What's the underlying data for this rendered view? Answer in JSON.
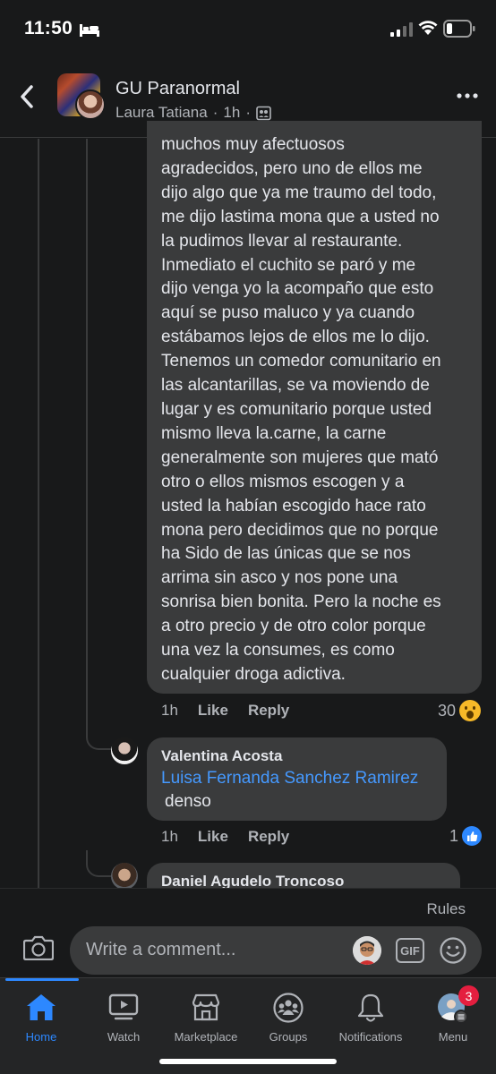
{
  "status_bar": {
    "time": "11:50"
  },
  "header": {
    "group_name": "GU Paranormal",
    "author": "Laura Tatiana",
    "separator": "·",
    "time": "1h",
    "separator2": "·"
  },
  "main_comment": {
    "lines": [
      "muchos muy afectuosos",
      "agradecidos, pero uno de ellos me",
      "dijo algo que ya me traumo del todo,",
      "me dijo lastima mona que a usted no",
      "la pudimos llevar al restaurante.",
      "Inmediato el cuchito se paró y me",
      "dijo venga yo la acompaño que esto",
      "aquí se puso maluco y ya cuando",
      "estábamos lejos de ellos me lo dijo.",
      "Tenemos un comedor comunitario en",
      "las alcantarillas, se va moviendo de",
      "lugar y es comunitario porque usted",
      "mismo lleva la.carne, la carne",
      "generalmente son mujeres que mató",
      "otro o ellos mismos escogen y a",
      "usted la habían escogido hace rato",
      "mona pero decidimos que no porque",
      "ha Sido de las únicas que se nos",
      "arrima sin asco y nos pone una",
      "sonrisa bien bonita. Pero la noche es",
      "a otro precio y de otro color porque",
      "una vez la consumes, es como",
      "cualquier droga adictiva."
    ],
    "time": "1h",
    "like_label": "Like",
    "reply_label": "Reply",
    "reaction_count": "30"
  },
  "reply_1": {
    "name": "Valentina Acosta",
    "mention": "Luisa Fernanda Sanchez Ramirez",
    "text": "denso",
    "time": "1h",
    "like_label": "Like",
    "reply_label": "Reply",
    "reaction_count": "1"
  },
  "reply_2": {
    "name": "Daniel Agudelo Troncoso"
  },
  "composer": {
    "rules_label": "Rules",
    "placeholder": "Write a comment...",
    "gif_label": "GIF"
  },
  "tabs": [
    {
      "label": "Home",
      "icon": "home-icon",
      "active": true
    },
    {
      "label": "Watch",
      "icon": "watch-icon"
    },
    {
      "label": "Marketplace",
      "icon": "marketplace-icon"
    },
    {
      "label": "Groups",
      "icon": "groups-icon"
    },
    {
      "label": "Notifications",
      "icon": "bell-icon"
    },
    {
      "label": "Menu",
      "icon": "menu-avatar-icon"
    }
  ],
  "menu_badge": "3",
  "colors": {
    "background": "#18191a",
    "bubble": "#3a3b3c",
    "accent": "#2d88ff",
    "text_secondary": "#b0b3b8"
  }
}
